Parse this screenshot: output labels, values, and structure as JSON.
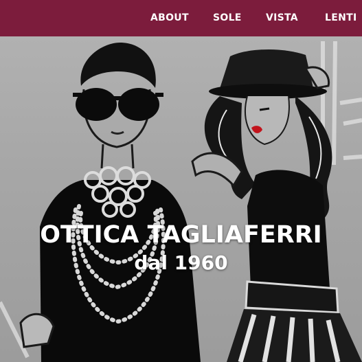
{
  "nav": {
    "items": [
      {
        "label": "ABOUT"
      },
      {
        "label": "SOLE"
      },
      {
        "label": "VISTA"
      },
      {
        "label": "LENTI"
      }
    ]
  },
  "hero": {
    "title": "OTTICA TAGLIAFERRI",
    "subtitle": "dal 1960"
  },
  "colors": {
    "navbar": "#7c1c3c",
    "nav_text": "#ffffff",
    "hero_text": "#ffffff",
    "lips": "#c2141c"
  }
}
